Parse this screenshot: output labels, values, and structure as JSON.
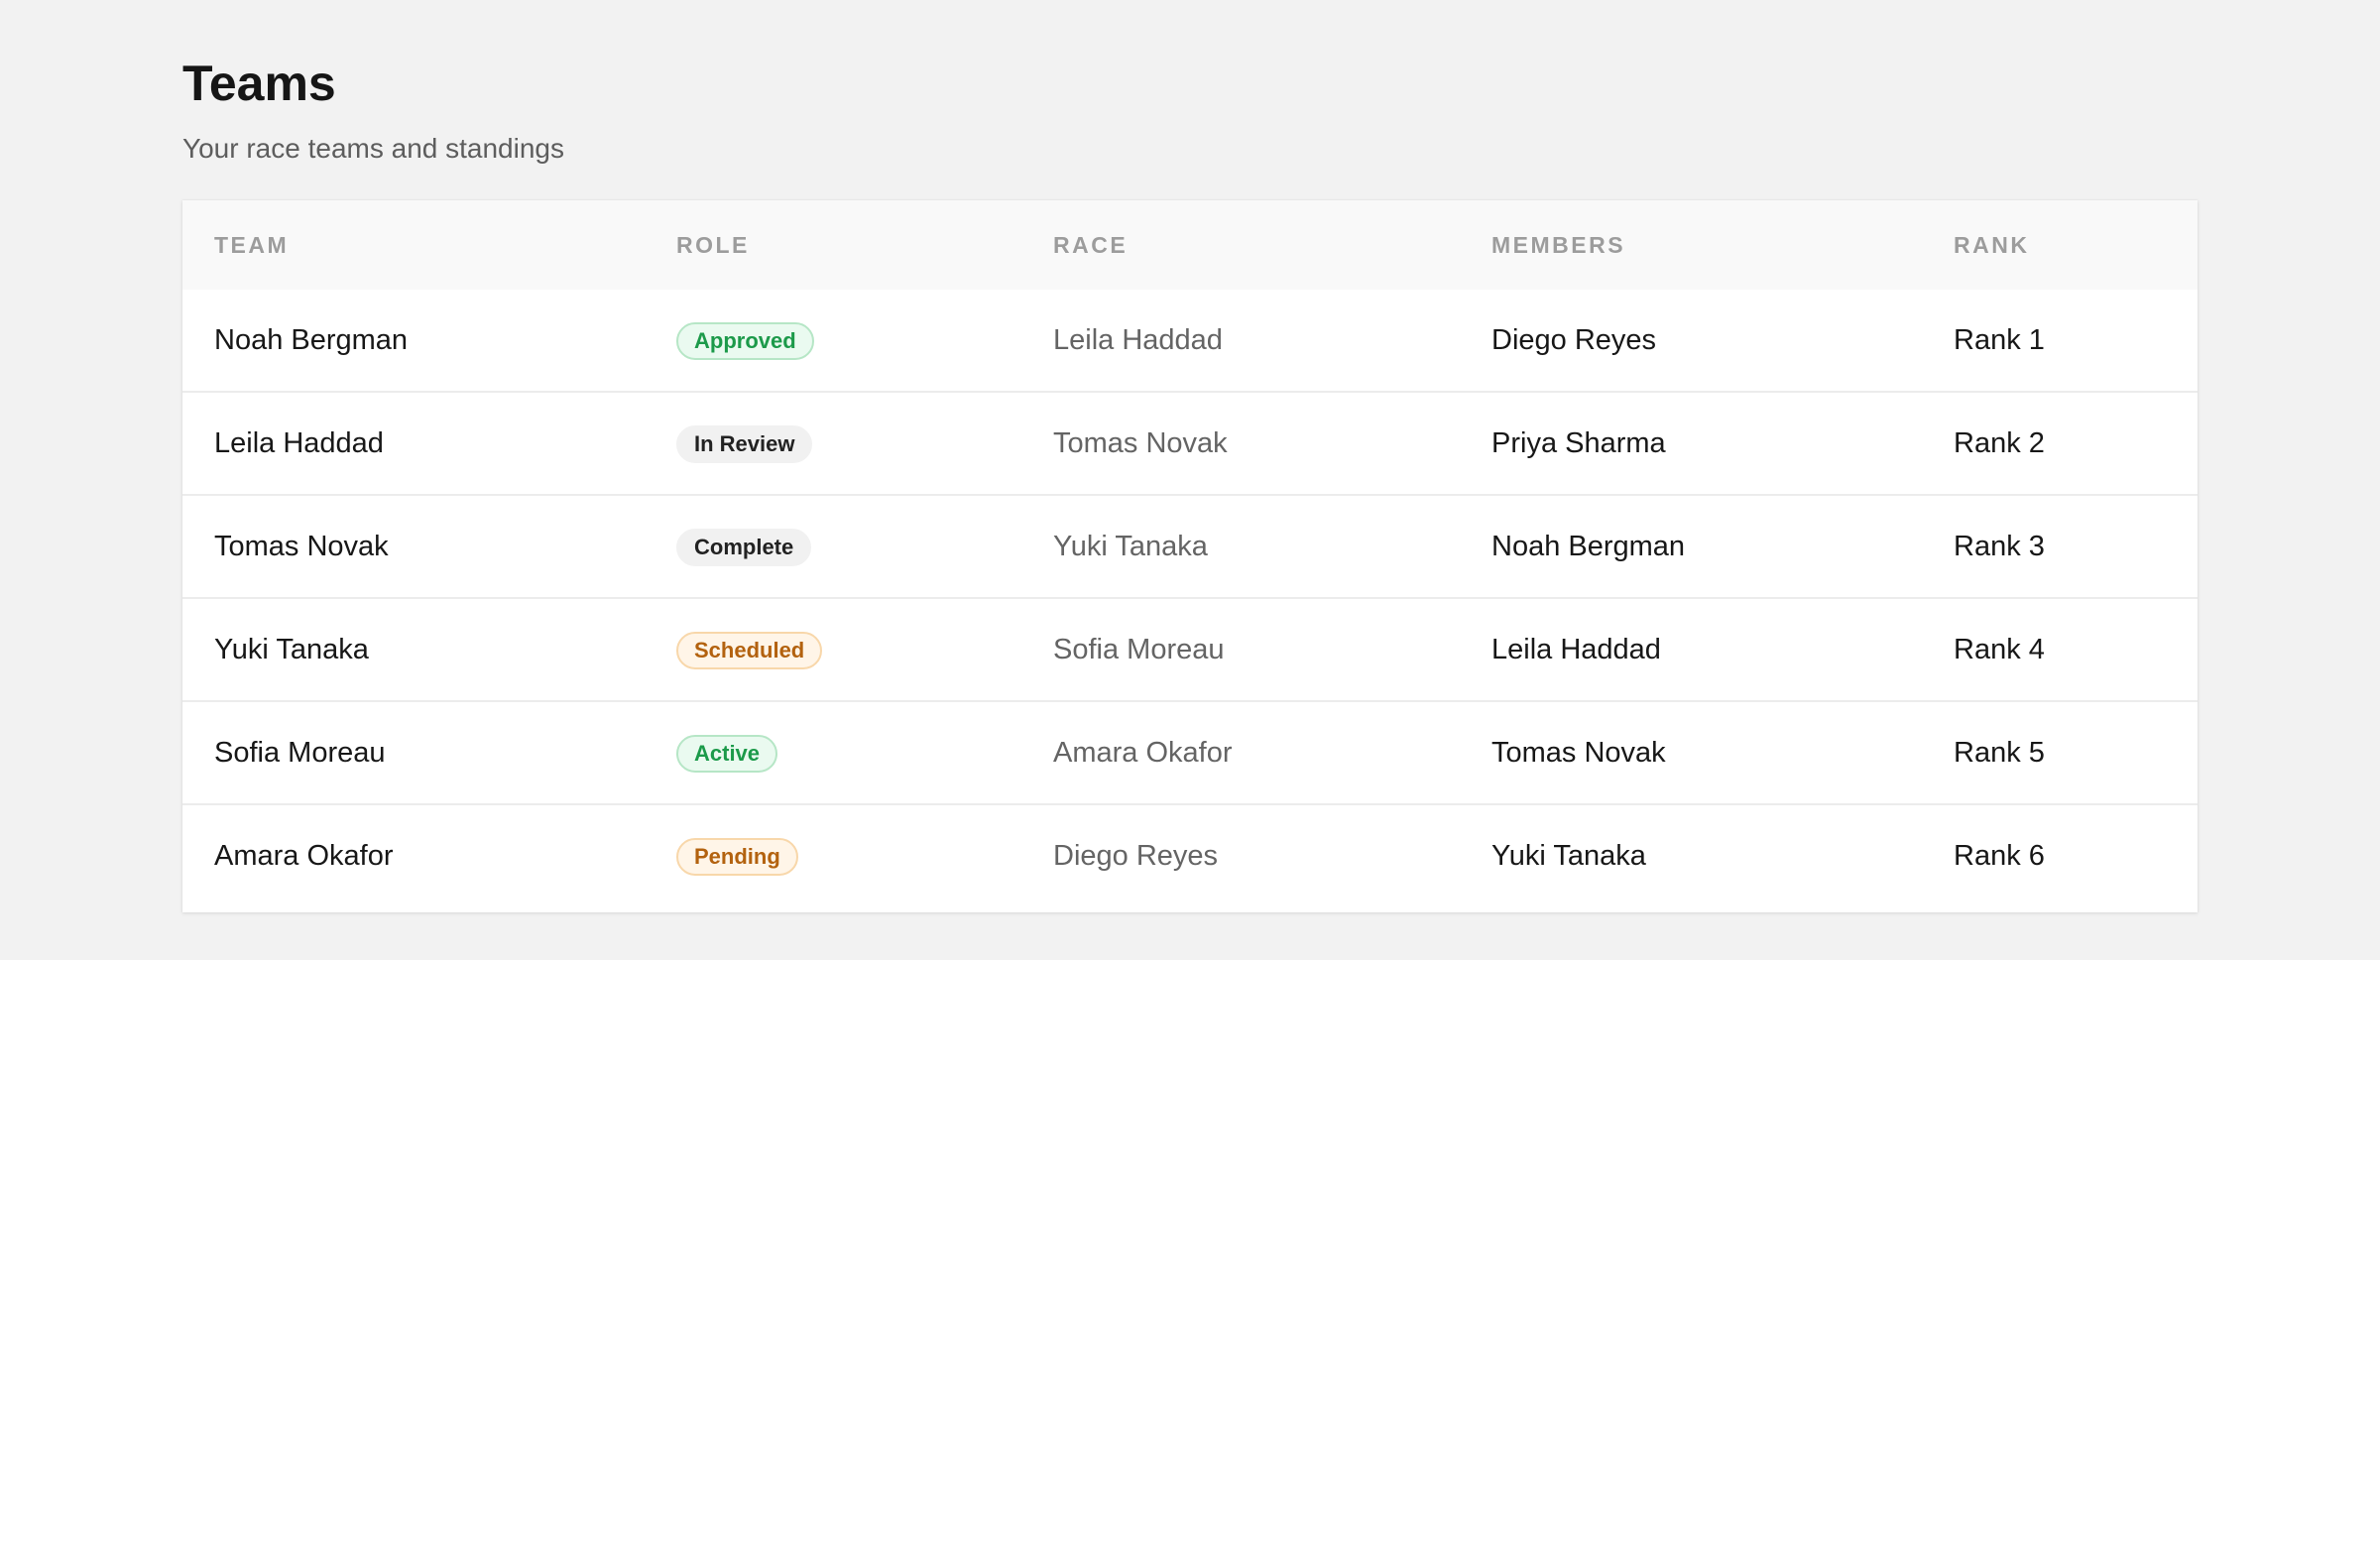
{
  "header": {
    "title": "Teams",
    "subtitle": "Your race teams and standings"
  },
  "table": {
    "columns": [
      "TEAM",
      "ROLE",
      "RACE",
      "MEMBERS",
      "RANK"
    ],
    "rows": [
      {
        "team": "Noah Bergman",
        "role": "Approved",
        "role_tone": "green",
        "race": "Leila Haddad",
        "members": "Diego Reyes",
        "rank": "Rank 1"
      },
      {
        "team": "Leila Haddad",
        "role": "In Review",
        "role_tone": "gray",
        "race": "Tomas Novak",
        "members": "Priya Sharma",
        "rank": "Rank 2"
      },
      {
        "team": "Tomas Novak",
        "role": "Complete",
        "role_tone": "gray",
        "race": "Yuki Tanaka",
        "members": "Noah Bergman",
        "rank": "Rank 3"
      },
      {
        "team": "Yuki Tanaka",
        "role": "Scheduled",
        "role_tone": "orange",
        "race": "Sofia Moreau",
        "members": "Leila Haddad",
        "rank": "Rank 4"
      },
      {
        "team": "Sofia Moreau",
        "role": "Active",
        "role_tone": "green",
        "race": "Amara Okafor",
        "members": "Tomas Novak",
        "rank": "Rank 5"
      },
      {
        "team": "Amara Okafor",
        "role": "Pending",
        "role_tone": "orange",
        "race": "Diego Reyes",
        "members": "Yuki Tanaka",
        "rank": "Rank 6"
      }
    ]
  },
  "colors": {
    "page_background": "#f2f2f2",
    "badge_green": "#1c9a4a",
    "badge_gray": "#222222",
    "badge_orange": "#b3620f"
  }
}
